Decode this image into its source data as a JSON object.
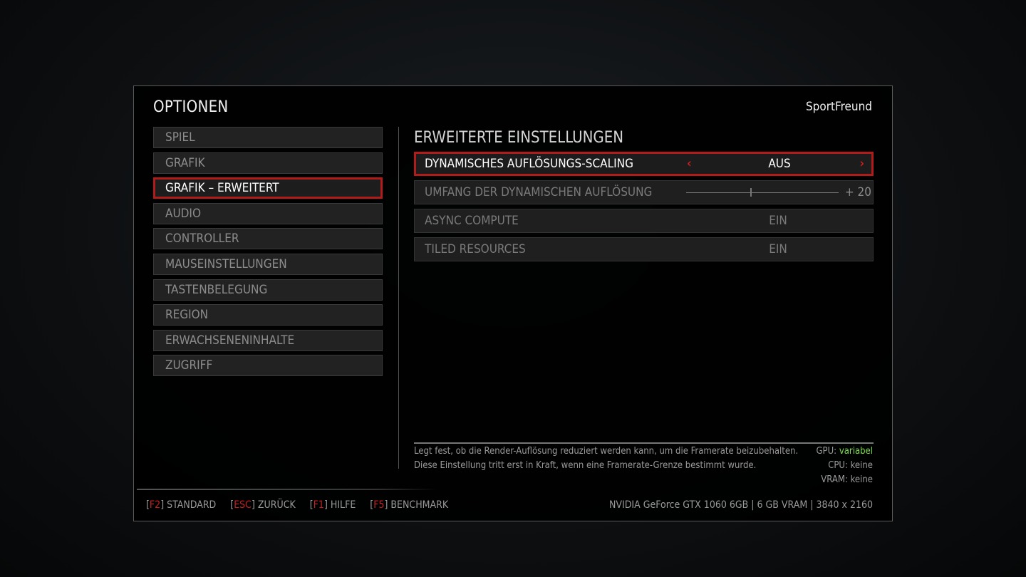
{
  "header": {
    "title": "OPTIONEN",
    "user": "SportFreund"
  },
  "nav": {
    "items": [
      {
        "label": "SPIEL",
        "active": false
      },
      {
        "label": "GRAFIK",
        "active": false
      },
      {
        "label": "GRAFIK – ERWEITERT",
        "active": true
      },
      {
        "label": "AUDIO",
        "active": false
      },
      {
        "label": "CONTROLLER",
        "active": false
      },
      {
        "label": "MAUSEINSTELLUNGEN",
        "active": false
      },
      {
        "label": "TASTENBELEGUNG",
        "active": false
      },
      {
        "label": "REGION",
        "active": false
      },
      {
        "label": "ERWACHSENENINHALTE",
        "active": false
      },
      {
        "label": "ZUGRIFF",
        "active": false
      }
    ]
  },
  "section": {
    "title": "ERWEITERTE EINSTELLUNGEN"
  },
  "settings": [
    {
      "label": "DYNAMISCHES AUFLÖSUNGS-SCALING",
      "value": "AUS",
      "type": "selector"
    },
    {
      "label": "UMFANG DER DYNAMISCHEN AUFLÖSUNG",
      "value": "+ 20",
      "type": "slider",
      "slider_fraction": 0.42
    },
    {
      "label": "ASYNC COMPUTE",
      "value": "EIN",
      "type": "selector"
    },
    {
      "label": "TILED RESOURCES",
      "value": "EIN",
      "type": "selector"
    }
  ],
  "info": {
    "line1": "Legt fest, ob die Render-Auflösung reduziert werden kann, um die Framerate beizubehalten.",
    "line2": "Diese Einstellung tritt erst in Kraft, wenn eine Framerate-Grenze bestimmt wurde."
  },
  "stats": {
    "gpu_label": "GPU:",
    "gpu_value": "variabel",
    "cpu": "CPU: keine",
    "vram": "VRAM: keine"
  },
  "footer": {
    "items": [
      {
        "key": "F2",
        "label": "STANDARD"
      },
      {
        "key": "ESC",
        "label": "ZURÜCK"
      },
      {
        "key": "F1",
        "label": "HILFE"
      },
      {
        "key": "F5",
        "label": "BENCHMARK"
      }
    ],
    "gpu_info": "NVIDIA GeForce GTX 1060 6GB | 6 GB VRAM | 3840 x 2160"
  },
  "colors": {
    "accent": "#b31b1b",
    "positive": "#7ddf4c"
  }
}
